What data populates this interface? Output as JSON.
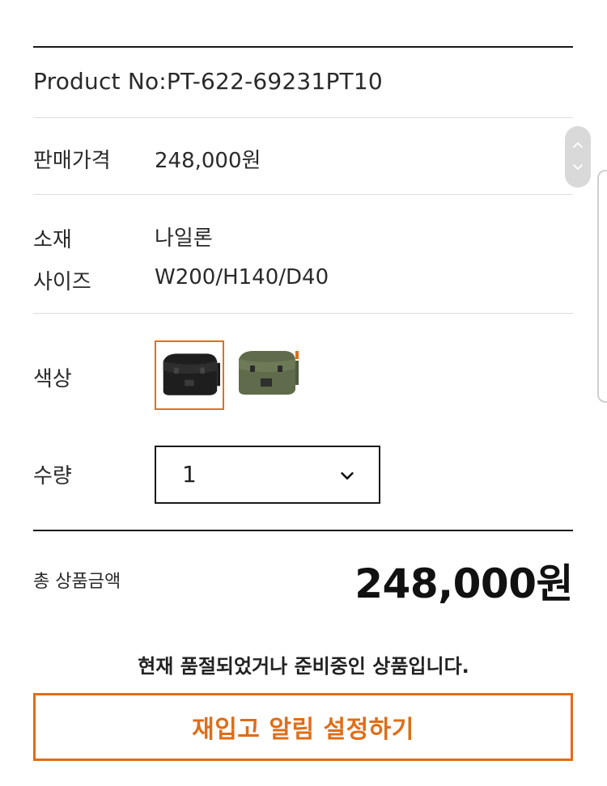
{
  "product": {
    "number": "Product No:PT-622-69231PT10"
  },
  "info_rows": {
    "price_label": "판매가격",
    "price_value": "248,000원",
    "material_label": "소재",
    "material_value": "나일론",
    "size_label": "사이즈",
    "size_value": "W200/H140/D40",
    "color_label": "색상",
    "quantity_label": "수량"
  },
  "color_options": [
    {
      "name": "black-bag",
      "color": "#1e1e1e",
      "selected": true
    },
    {
      "name": "olive-bag",
      "color": "#5f6b4b",
      "selected": false
    }
  ],
  "colors": {
    "accent": "#e06d17",
    "selected_border": "#e07019"
  },
  "quantity": {
    "selected_value": "1",
    "icon": "chevron-down-icon"
  },
  "total": {
    "label": "총 상품금액",
    "value": "248,000원"
  },
  "status": {
    "message": "현재 품절되었거나 준비중인 상품입니다."
  },
  "actions": {
    "restock_label": "재입고 알림 설정하기"
  },
  "scroll_control": {
    "up_icon": "chevron-up-icon",
    "down_icon": "chevron-down-icon"
  }
}
